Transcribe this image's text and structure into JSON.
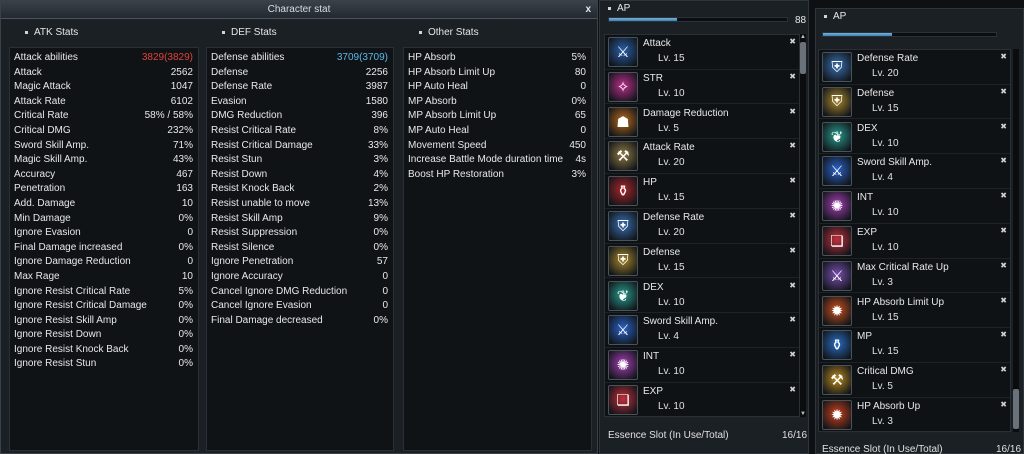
{
  "window": {
    "title": "Character stat",
    "close": "x"
  },
  "atk": {
    "header": "ATK Stats",
    "rows": [
      {
        "label": "Attack abilities",
        "value": "3829(3829)",
        "hl": "red"
      },
      {
        "label": "Attack",
        "value": "2562"
      },
      {
        "label": "Magic Attack",
        "value": "1047"
      },
      {
        "label": "Attack Rate",
        "value": "6102"
      },
      {
        "label": "Critical Rate",
        "value": "58% / 58%"
      },
      {
        "label": "Critical DMG",
        "value": "232%"
      },
      {
        "label": "Sword Skill Amp.",
        "value": "71%"
      },
      {
        "label": "Magic Skill Amp.",
        "value": "43%"
      },
      {
        "label": "Accuracy",
        "value": "467"
      },
      {
        "label": "Penetration",
        "value": "163"
      },
      {
        "label": "Add. Damage",
        "value": "10"
      },
      {
        "label": "Min Damage",
        "value": "0%"
      },
      {
        "label": "Ignore Evasion",
        "value": "0"
      },
      {
        "label": "Final Damage increased",
        "value": "0%"
      },
      {
        "label": "Ignore Damage Reduction",
        "value": "0"
      },
      {
        "label": "Max Rage",
        "value": "10"
      },
      {
        "label": "Ignore Resist Critical Rate",
        "value": "5%"
      },
      {
        "label": "Ignore Resist Critical Damage",
        "value": "0%"
      },
      {
        "label": "Ignore Resist Skill Amp",
        "value": "0%"
      },
      {
        "label": "Ignore Resist Down",
        "value": "0%"
      },
      {
        "label": "Ignore Resist Knock Back",
        "value": "0%"
      },
      {
        "label": "Ignore Resist Stun",
        "value": "0%"
      }
    ]
  },
  "def": {
    "header": "DEF Stats",
    "rows": [
      {
        "label": "Defense abilities",
        "value": "3709(3709)",
        "hl": "blue"
      },
      {
        "label": "Defense",
        "value": "2256"
      },
      {
        "label": "Defense Rate",
        "value": "3987"
      },
      {
        "label": "Evasion",
        "value": "1580"
      },
      {
        "label": "DMG Reduction",
        "value": "396"
      },
      {
        "label": "Resist Critical Rate",
        "value": "8%"
      },
      {
        "label": "Resist Critical Damage",
        "value": "33%"
      },
      {
        "label": "Resist Stun",
        "value": "3%"
      },
      {
        "label": "Resist Down",
        "value": "4%"
      },
      {
        "label": "Resist Knock Back",
        "value": "2%"
      },
      {
        "label": "Resist unable to move",
        "value": "13%"
      },
      {
        "label": "Resist Skill Amp",
        "value": "9%"
      },
      {
        "label": "Resist Suppression",
        "value": "0%"
      },
      {
        "label": "Resist Silence",
        "value": "0%"
      },
      {
        "label": "Ignore Penetration",
        "value": "57"
      },
      {
        "label": "Ignore Accuracy",
        "value": "0"
      },
      {
        "label": "Cancel Ignore DMG Reduction",
        "value": "0"
      },
      {
        "label": "Cancel Ignore Evasion",
        "value": "0"
      },
      {
        "label": "Final Damage decreased",
        "value": "0%"
      }
    ]
  },
  "other": {
    "header": "Other Stats",
    "rows": [
      {
        "label": "HP Absorb",
        "value": "5%"
      },
      {
        "label": "HP Absorb Limit Up",
        "value": "80"
      },
      {
        "label": "HP Auto Heal",
        "value": "0"
      },
      {
        "label": "MP Absorb",
        "value": "0%"
      },
      {
        "label": "MP Absorb Limit Up",
        "value": "65"
      },
      {
        "label": "MP Auto Heal",
        "value": "0"
      },
      {
        "label": "Movement Speed",
        "value": "450"
      },
      {
        "label": "Increase Battle Mode duration time",
        "value": "4s"
      },
      {
        "label": "Boost HP Restoration",
        "value": "3%"
      }
    ]
  },
  "ap_left": {
    "header": "AP",
    "value": "88",
    "fill_fraction": 0.38,
    "footer_label": "Essence Slot (In Use/Total)",
    "footer_value": "16/16",
    "items": [
      {
        "name": "Attack",
        "level": "Lv. 15",
        "icon": "sword-icon",
        "glyph": "⚔",
        "color": "#2a5fa8"
      },
      {
        "name": "STR",
        "level": "Lv. 10",
        "icon": "str-rune-icon",
        "glyph": "✧",
        "color": "#b8308a"
      },
      {
        "name": "Damage Reduction",
        "level": "Lv. 5",
        "icon": "silhouette-icon",
        "glyph": "☗",
        "color": "#b56a1e"
      },
      {
        "name": "Attack Rate",
        "level": "Lv. 20",
        "icon": "hammer-icon",
        "glyph": "⚒",
        "color": "#8f7a46"
      },
      {
        "name": "HP",
        "level": "Lv. 15",
        "icon": "hp-potion-icon",
        "glyph": "⚱",
        "color": "#a8262a"
      },
      {
        "name": "Defense Rate",
        "level": "Lv. 20",
        "icon": "shield-icon",
        "glyph": "⛨",
        "color": "#3a6fb0"
      },
      {
        "name": "Defense",
        "level": "Lv. 15",
        "icon": "golden-shield-icon",
        "glyph": "⛨",
        "color": "#a8872e"
      },
      {
        "name": "DEX",
        "level": "Lv. 10",
        "icon": "dex-feather-icon",
        "glyph": "❦",
        "color": "#2a9a8e"
      },
      {
        "name": "Sword Skill Amp.",
        "level": "Lv. 4",
        "icon": "blue-blade-icon",
        "glyph": "⚔",
        "color": "#2b63c8"
      },
      {
        "name": "INT",
        "level": "Lv. 10",
        "icon": "int-rune-icon",
        "glyph": "✺",
        "color": "#a43fb4"
      },
      {
        "name": "EXP",
        "level": "Lv. 10",
        "icon": "book-icon",
        "glyph": "❏",
        "color": "#c0303c"
      }
    ]
  },
  "ap_right": {
    "header": "AP",
    "fill_fraction": 0.4,
    "footer_label": "Essence Slot (In Use/Total)",
    "footer_value": "16/16",
    "items": [
      {
        "name": "Defense Rate",
        "level": "Lv. 20",
        "icon": "shield-icon",
        "glyph": "⛨",
        "color": "#3a6fb0"
      },
      {
        "name": "Defense",
        "level": "Lv. 15",
        "icon": "golden-shield-icon",
        "glyph": "⛨",
        "color": "#a8872e"
      },
      {
        "name": "DEX",
        "level": "Lv. 10",
        "icon": "dex-feather-icon",
        "glyph": "❦",
        "color": "#2a9a8e"
      },
      {
        "name": "Sword Skill Amp.",
        "level": "Lv. 4",
        "icon": "blue-blade-icon",
        "glyph": "⚔",
        "color": "#2b63c8"
      },
      {
        "name": "INT",
        "level": "Lv. 10",
        "icon": "int-rune-icon",
        "glyph": "✺",
        "color": "#a43fb4"
      },
      {
        "name": "EXP",
        "level": "Lv. 10",
        "icon": "book-icon",
        "glyph": "❏",
        "color": "#c0303c"
      },
      {
        "name": "Max Critical Rate Up",
        "level": "Lv. 3",
        "icon": "dagger-icon",
        "glyph": "⚔",
        "color": "#7a4fb0"
      },
      {
        "name": "HP Absorb Limit Up",
        "level": "Lv. 15",
        "icon": "fire-icon",
        "glyph": "✹",
        "color": "#c8501e"
      },
      {
        "name": "MP",
        "level": "Lv. 15",
        "icon": "mp-potion-icon",
        "glyph": "⚱",
        "color": "#2a6cc0"
      },
      {
        "name": "Critical DMG",
        "level": "Lv. 5",
        "icon": "gold-blade-icon",
        "glyph": "⚒",
        "color": "#b88a22"
      },
      {
        "name": "HP Absorb Up",
        "level": "Lv. 3",
        "icon": "flame-icon",
        "glyph": "✹",
        "color": "#c8401e"
      }
    ]
  }
}
